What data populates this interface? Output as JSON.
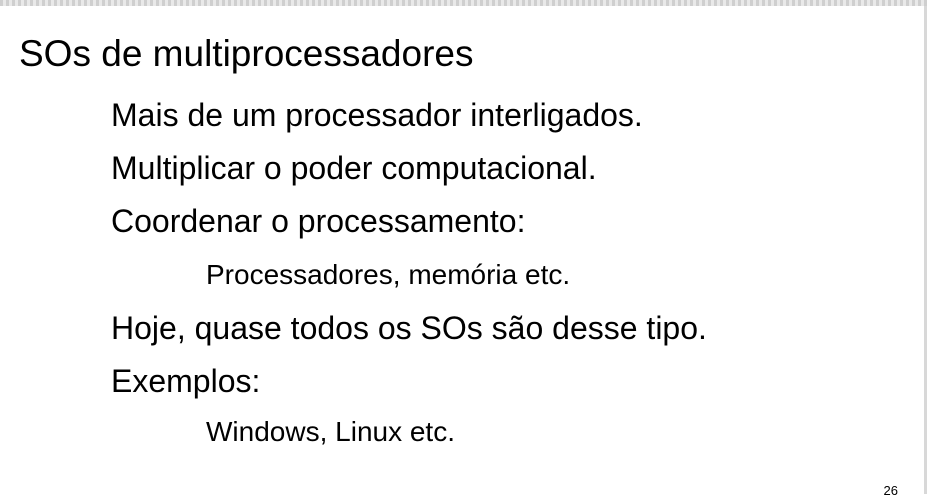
{
  "slide": {
    "title": "SOs de multiprocessadores",
    "bullets": [
      {
        "text": "Mais de um processador interligados."
      },
      {
        "text": "Multiplicar o poder computacional."
      },
      {
        "text": "Coordenar o processamento:"
      },
      {
        "text": "Processadores, memória etc."
      },
      {
        "text": "Hoje, quase todos os SOs são desse tipo."
      },
      {
        "text": "Exemplos:"
      },
      {
        "text": "Windows, Linux etc."
      }
    ],
    "page_number": "26"
  }
}
